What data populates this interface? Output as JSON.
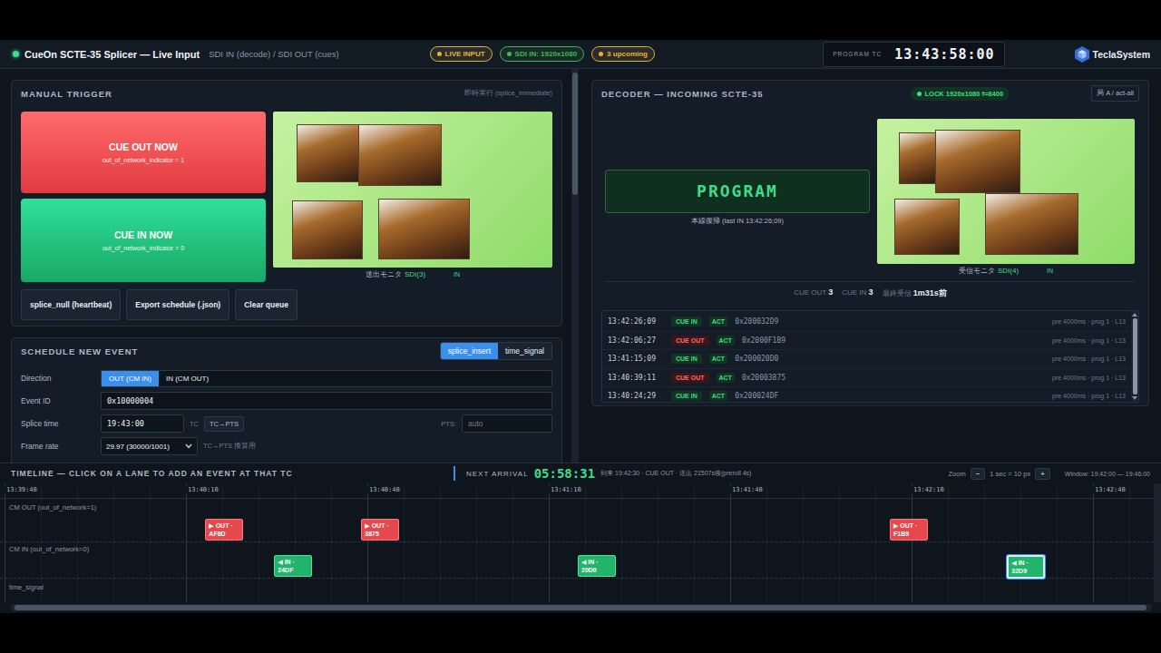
{
  "header": {
    "title": "CueOn SCTE-35 Splicer — Live Input",
    "subtitle": "SDI IN (decode) / SDI OUT (cues)",
    "status_on": true,
    "badges": [
      {
        "label": "LIVE INPUT",
        "color": "#e3b341"
      },
      {
        "label": "SDI IN: 1920x1080",
        "color": "#3fb950"
      },
      {
        "label": "3 upcoming",
        "color": "#e3b341"
      }
    ],
    "clock": {
      "label": "PROGRAM TC",
      "value": "13:43:58:00"
    },
    "logo": "TeclaSystem"
  },
  "manual_trigger": {
    "title": "MANUAL TRIGGER",
    "hint": "即時実行 (splice_immediate)",
    "buttons": [
      {
        "label": "CUE OUT NOW",
        "detail": "out_of_network_indicator = 1",
        "kind": "out"
      },
      {
        "label": "CUE IN NOW",
        "detail": "out_of_network_indicator = 0",
        "kind": "in"
      }
    ],
    "monitor": {
      "label": "送出モニタ",
      "source": "SDI(3)",
      "state": "IN"
    },
    "actions": [
      "splice_null (heartbeat)",
      "Export schedule (.json)",
      "Clear queue"
    ]
  },
  "schedule": {
    "title": "SCHEDULE NEW EVENT",
    "tabs": [
      {
        "label": "splice_insert",
        "selected": true
      },
      {
        "label": "time_signal",
        "selected": false
      }
    ],
    "direction": {
      "label": "Direction",
      "options": [
        {
          "label": "OUT (CM IN)",
          "selected": true
        },
        {
          "label": "IN (CM OUT)",
          "selected": false
        }
      ]
    },
    "event_id": {
      "label": "Event ID",
      "value": "0x10000004"
    },
    "splice_time": {
      "label": "Splice time",
      "value": "19:43:00",
      "unit": "TC",
      "convert": "TC→PTS",
      "pts_label": "PTS:",
      "pts_placeholder": "auto"
    },
    "frame_rate": {
      "label": "Frame rate",
      "value": "29.97 (30000/1001)",
      "note": "TC↔PTS 換算用"
    }
  },
  "decoder": {
    "title": "DECODER — INCOMING SCTE-35",
    "lock": "LOCK 1920x1080 f=8400",
    "station": "局 A / act-all",
    "state": "PROGRAM",
    "state_note": "本線復帰 (last IN 13:42:26;09)",
    "monitor": {
      "label": "受信モニタ",
      "source": "SDI(4)",
      "state": "IN"
    },
    "stats": [
      {
        "label": "CUE OUT",
        "value": "3"
      },
      {
        "label": "CUE IN",
        "value": "3"
      },
      {
        "label": "最終受信",
        "value": "1m31s前"
      }
    ],
    "log": [
      {
        "time": "13:42:26;09",
        "direction": "CUE IN",
        "kind": "in",
        "status": "ACT",
        "id": "0x200032D9",
        "detail": "pre 4000ms · prog 1 · L13"
      },
      {
        "time": "13:42:06;27",
        "direction": "CUE OUT",
        "kind": "out",
        "status": "ACT",
        "id": "0x2000F1B9",
        "detail": "pre 4000ms · prog 1 · L13"
      },
      {
        "time": "13:41:15;09",
        "direction": "CUE IN",
        "kind": "in",
        "status": "ACT",
        "id": "0x200020D0",
        "detail": "pre 4000ms · prog 1 · L13"
      },
      {
        "time": "13:40:39;11",
        "direction": "CUE OUT",
        "kind": "out",
        "status": "ACT",
        "id": "0x20003875",
        "detail": "pre 4000ms · prog 1 · L13"
      },
      {
        "time": "13:40:24;29",
        "direction": "CUE IN",
        "kind": "in",
        "status": "ACT",
        "id": "0x200024DF",
        "detail": "pre 4000ms · prog 1 · L13"
      }
    ]
  },
  "timeline": {
    "title": "TIMELINE — CLICK ON A LANE TO ADD AN EVENT AT THAT TC",
    "next": {
      "label": "NEXT ARRIVAL",
      "countdown": "05:58:31",
      "detail": "到来 19:42:30 · CUE OUT · 送出 21507s後(preroll 4s)"
    },
    "zoom": {
      "label": "Zoom",
      "minus": "−",
      "scale": "1 sec = 10 px",
      "plus": "+"
    },
    "window": "Window: 19:42:00 — 19:46:00",
    "ticks": [
      "13:39:40",
      "13:40:10",
      "13:40:40",
      "13:41:10",
      "13:41:40",
      "13:42:10",
      "13:42:40"
    ],
    "lanes": [
      {
        "label": "CM OUT (out_of_network=1)",
        "kind": "out"
      },
      {
        "label": "CM IN (out_of_network=0)",
        "kind": "in"
      },
      {
        "label": "time_signal",
        "kind": "signal"
      }
    ],
    "events": [
      {
        "lane": "out",
        "label": "▶ OUT ·",
        "code": "AF8D",
        "t": 33.2,
        "selected": false
      },
      {
        "lane": "in",
        "label": "◀ IN ·",
        "code": "24DF",
        "t": 44.6,
        "selected": false
      },
      {
        "lane": "out",
        "label": "▶ OUT ·",
        "code": "3875",
        "t": 59.0,
        "selected": false
      },
      {
        "lane": "in",
        "label": "◀ IN ·",
        "code": "20D0",
        "t": 94.8,
        "selected": false
      },
      {
        "lane": "out",
        "label": "▶ OUT ·",
        "code": "F1B9",
        "t": 146.4,
        "selected": false
      },
      {
        "lane": "in",
        "label": "◀ IN ·",
        "code": "32D9",
        "t": 165.8,
        "selected": true
      }
    ]
  }
}
